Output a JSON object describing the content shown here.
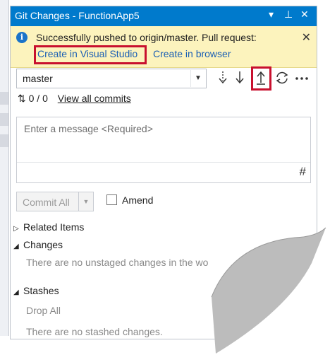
{
  "window": {
    "title": "Git Changes - FunctionApp5",
    "controls": [
      "▾",
      "⊥",
      "✕"
    ]
  },
  "infobar": {
    "message": "Successfully pushed to origin/master. Pull request:",
    "link_visual_studio": "Create in Visual Studio",
    "link_browser": "Create in browser",
    "close": "✕"
  },
  "branch": {
    "selected": "master"
  },
  "sync": {
    "counts": "0 / 0",
    "view_commits": "View all commits"
  },
  "commit_message": {
    "placeholder": "Enter a message <Required>",
    "hash_icon": "#"
  },
  "commit": {
    "commit_all": "Commit All",
    "amend": "Amend"
  },
  "sections": {
    "related_items": "Related Items",
    "changes": "Changes",
    "changes_empty": "There are no unstaged changes in the wo",
    "stashes": "Stashes",
    "drop_all": "Drop All",
    "stashes_empty": "There are no stashed changes."
  },
  "colors": {
    "titlebar": "#007acc",
    "infobar": "#fcf3bd",
    "highlight": "#c8102e",
    "link": "#1a5fb4"
  }
}
